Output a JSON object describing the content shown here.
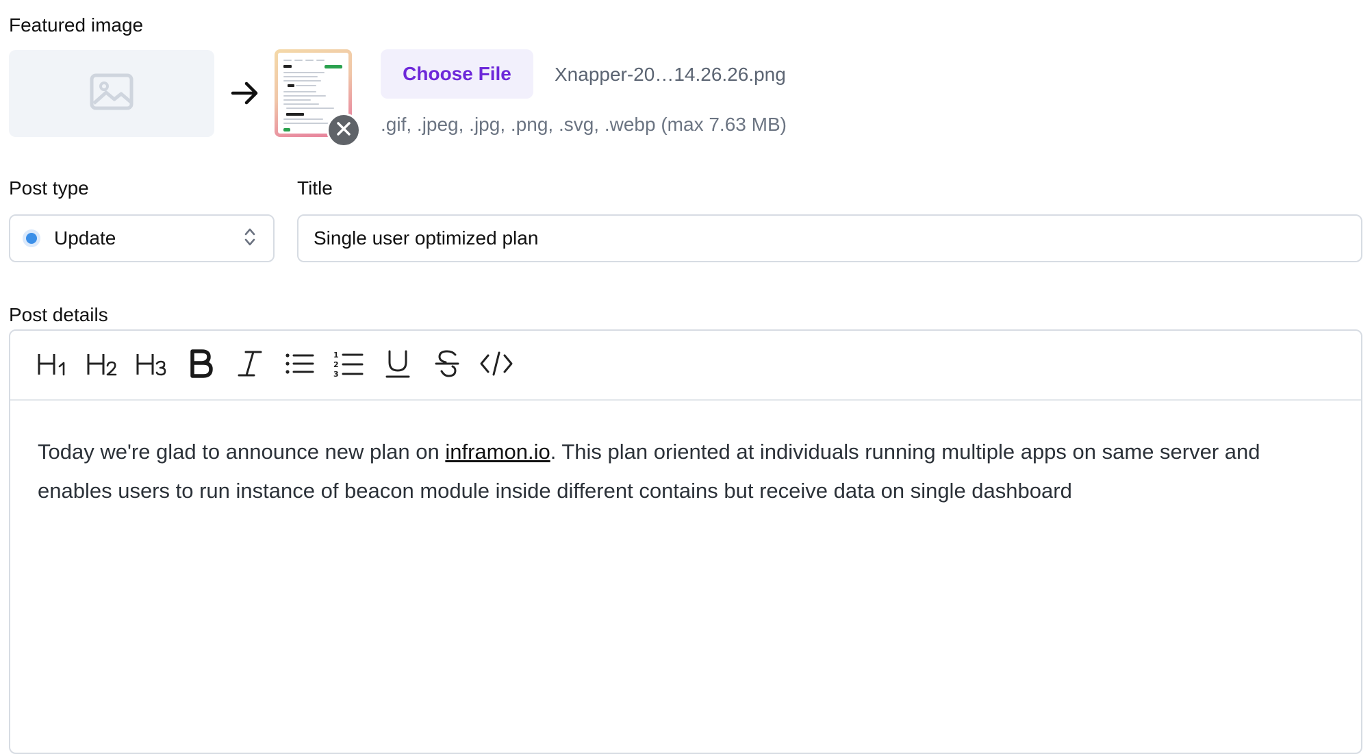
{
  "featured_image": {
    "label": "Featured image",
    "choose_file_label": "Choose File",
    "file_name": "Xnapper-20…14.26.26.png",
    "allowed_types": ".gif, .jpeg, .jpg, .png, .svg, .webp (max 7.63 MB)",
    "placeholder_icon": "image-icon",
    "arrow_icon": "arrow-right-icon",
    "remove_icon": "close-icon"
  },
  "post_type": {
    "label": "Post type",
    "selected": "Update",
    "status_color": "#3b8fe8",
    "chevron_icon": "chevron-up-down-icon"
  },
  "title": {
    "label": "Title",
    "value": "Single user optimized plan"
  },
  "post_details": {
    "label": "Post details",
    "toolbar": [
      {
        "name": "heading-1",
        "icon": "h1-icon"
      },
      {
        "name": "heading-2",
        "icon": "h2-icon"
      },
      {
        "name": "heading-3",
        "icon": "h3-icon"
      },
      {
        "name": "bold",
        "icon": "bold-icon"
      },
      {
        "name": "italic",
        "icon": "italic-icon"
      },
      {
        "name": "bullet-list",
        "icon": "bullet-list-icon"
      },
      {
        "name": "ordered-list",
        "icon": "ordered-list-icon"
      },
      {
        "name": "underline",
        "icon": "underline-icon"
      },
      {
        "name": "strikethrough",
        "icon": "strikethrough-icon"
      },
      {
        "name": "code",
        "icon": "code-icon"
      }
    ],
    "content_before_link": "Today we're glad to announce new plan on ",
    "content_link": "inframon.io",
    "content_after_link": ". This plan oriented at individuals running multiple apps on same server and enables users to run instance of beacon module inside different contains but receive data on single dashboard"
  },
  "colors": {
    "accent": "#6d28d9",
    "accent_bg": "#f2f0fc",
    "border": "#d7dce3"
  }
}
